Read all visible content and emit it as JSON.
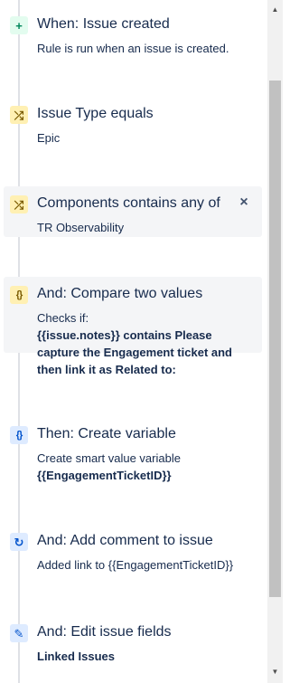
{
  "steps": [
    {
      "icon": "plus-icon",
      "glyph": "+",
      "title": "When: Issue created",
      "desc": "Rule is run when an issue is created."
    },
    {
      "icon": "shuffle-icon",
      "glyph": "⤮",
      "title": "Issue Type equals",
      "desc": "Epic"
    },
    {
      "icon": "shuffle-icon",
      "glyph": "⤮",
      "title": "Components contains any of",
      "desc": "TR Observability",
      "close": "×"
    },
    {
      "icon": "braces-icon",
      "glyph": "{}",
      "title": "And: Compare two values",
      "desc": "Checks if:",
      "desc_bold": "{{issue.notes}} contains Please capture the Engagement ticket and then link it as Related to:"
    },
    {
      "icon": "braces-icon",
      "glyph": "{}",
      "title": "Then: Create variable",
      "desc": "Create smart value variable",
      "desc_bold": "{{EngagementTicketID}}"
    },
    {
      "icon": "refresh-icon",
      "glyph": "↻",
      "title": "And: Add comment to issue",
      "desc": "Added link to {{EngagementTicketID}}"
    },
    {
      "icon": "pencil-icon",
      "glyph": "✎",
      "title": "And: Edit issue fields",
      "desc_bold": "Linked Issues"
    }
  ],
  "colors": {
    "trigger_bg": "#e3fcef",
    "condition_bg": "#fff0b3",
    "action_bg": "#deebff",
    "selected_bg": "#f4f5f7",
    "text": "#172b4d"
  }
}
